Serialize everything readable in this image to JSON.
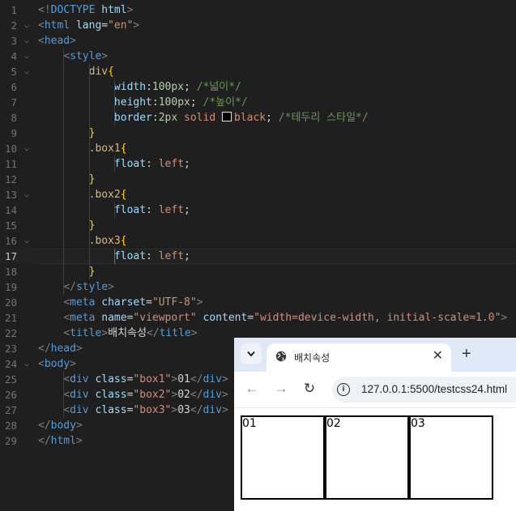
{
  "editor": {
    "current_line": 17,
    "lines": [
      {
        "n": "1",
        "tokens": [
          [
            "brk",
            "<!"
          ],
          [
            "doc",
            "DOCTYPE"
          ],
          [
            "txt",
            " "
          ],
          [
            "attr",
            "html"
          ],
          [
            "brk",
            ">"
          ]
        ]
      },
      {
        "n": "2",
        "fold": true,
        "tokens": [
          [
            "brk",
            "<"
          ],
          [
            "tag",
            "html"
          ],
          [
            "txt",
            " "
          ],
          [
            "attr",
            "lang"
          ],
          [
            "txt",
            "="
          ],
          [
            "str",
            "\"en\""
          ],
          [
            "brk",
            ">"
          ]
        ]
      },
      {
        "n": "3",
        "fold": true,
        "tokens": [
          [
            "brk",
            "<"
          ],
          [
            "tag",
            "head"
          ],
          [
            "brk",
            ">"
          ]
        ]
      },
      {
        "n": "4",
        "fold": true,
        "tokens": [
          [
            "txt",
            "    "
          ],
          [
            "brk",
            "<"
          ],
          [
            "tag",
            "style"
          ],
          [
            "brk",
            ">"
          ]
        ]
      },
      {
        "n": "5",
        "fold": true,
        "tokens": [
          [
            "txt",
            "        "
          ],
          [
            "sel",
            "div"
          ],
          [
            "y1",
            "{"
          ]
        ]
      },
      {
        "n": "6",
        "tokens": [
          [
            "txt",
            "            "
          ],
          [
            "prop",
            "width"
          ],
          [
            "txt",
            ":"
          ],
          [
            "num",
            "100px"
          ],
          [
            "txt",
            "; "
          ],
          [
            "cmt",
            "/*넓이*/"
          ]
        ]
      },
      {
        "n": "7",
        "tokens": [
          [
            "txt",
            "            "
          ],
          [
            "prop",
            "height"
          ],
          [
            "txt",
            ":"
          ],
          [
            "num",
            "100px"
          ],
          [
            "txt",
            "; "
          ],
          [
            "cmt",
            "/*높이*/"
          ]
        ]
      },
      {
        "n": "8",
        "tokens": [
          [
            "txt",
            "            "
          ],
          [
            "prop",
            "border"
          ],
          [
            "txt",
            ":"
          ],
          [
            "num",
            "2px"
          ],
          [
            "txt",
            " "
          ],
          [
            "val",
            "solid"
          ],
          [
            "txt",
            " "
          ],
          [
            "swatch",
            ""
          ],
          [
            "val",
            "black"
          ],
          [
            "txt",
            "; "
          ],
          [
            "cmt",
            "/*테두리 스타일*/"
          ]
        ]
      },
      {
        "n": "9",
        "tokens": [
          [
            "txt",
            "        "
          ],
          [
            "y1",
            "}"
          ]
        ]
      },
      {
        "n": "10",
        "fold": true,
        "tokens": [
          [
            "txt",
            "        "
          ],
          [
            "sel",
            ".box1"
          ],
          [
            "y1",
            "{"
          ]
        ]
      },
      {
        "n": "11",
        "tokens": [
          [
            "txt",
            "            "
          ],
          [
            "prop",
            "float"
          ],
          [
            "txt",
            ": "
          ],
          [
            "val",
            "left"
          ],
          [
            "txt",
            ";"
          ]
        ]
      },
      {
        "n": "12",
        "tokens": [
          [
            "txt",
            "        "
          ],
          [
            "y1",
            "}"
          ]
        ]
      },
      {
        "n": "13",
        "fold": true,
        "tokens": [
          [
            "txt",
            "        "
          ],
          [
            "sel",
            ".box2"
          ],
          [
            "y1",
            "{"
          ]
        ]
      },
      {
        "n": "14",
        "tokens": [
          [
            "txt",
            "            "
          ],
          [
            "prop",
            "float"
          ],
          [
            "txt",
            ": "
          ],
          [
            "val",
            "left"
          ],
          [
            "txt",
            ";"
          ]
        ]
      },
      {
        "n": "15",
        "tokens": [
          [
            "txt",
            "        "
          ],
          [
            "y1",
            "}"
          ]
        ]
      },
      {
        "n": "16",
        "fold": true,
        "tokens": [
          [
            "txt",
            "        "
          ],
          [
            "sel",
            ".box3"
          ],
          [
            "y1",
            "{"
          ]
        ]
      },
      {
        "n": "17",
        "tokens": [
          [
            "txt",
            "            "
          ],
          [
            "prop",
            "float"
          ],
          [
            "txt",
            ": "
          ],
          [
            "val",
            "left"
          ],
          [
            "txt",
            ";"
          ]
        ]
      },
      {
        "n": "18",
        "tokens": [
          [
            "txt",
            "        "
          ],
          [
            "y1",
            "}"
          ]
        ]
      },
      {
        "n": "19",
        "tokens": [
          [
            "txt",
            "    "
          ],
          [
            "brk",
            "</"
          ],
          [
            "tag",
            "style"
          ],
          [
            "brk",
            ">"
          ]
        ]
      },
      {
        "n": "20",
        "tokens": [
          [
            "txt",
            "    "
          ],
          [
            "brk",
            "<"
          ],
          [
            "tag",
            "meta"
          ],
          [
            "txt",
            " "
          ],
          [
            "attr",
            "charset"
          ],
          [
            "txt",
            "="
          ],
          [
            "str",
            "\"UTF-8\""
          ],
          [
            "brk",
            ">"
          ]
        ]
      },
      {
        "n": "21",
        "tokens": [
          [
            "txt",
            "    "
          ],
          [
            "brk",
            "<"
          ],
          [
            "tag",
            "meta"
          ],
          [
            "txt",
            " "
          ],
          [
            "attr",
            "name"
          ],
          [
            "txt",
            "="
          ],
          [
            "str",
            "\"viewport\""
          ],
          [
            "txt",
            " "
          ],
          [
            "attr",
            "content"
          ],
          [
            "txt",
            "="
          ],
          [
            "str",
            "\"width=device-width, initial-scale=1.0\""
          ],
          [
            "brk",
            ">"
          ]
        ]
      },
      {
        "n": "22",
        "tokens": [
          [
            "txt",
            "    "
          ],
          [
            "brk",
            "<"
          ],
          [
            "tag",
            "title"
          ],
          [
            "brk",
            ">"
          ],
          [
            "txt",
            "배치속성"
          ],
          [
            "brk",
            "</"
          ],
          [
            "tag",
            "title"
          ],
          [
            "brk",
            ">"
          ]
        ]
      },
      {
        "n": "23",
        "tokens": [
          [
            "brk",
            "</"
          ],
          [
            "tag",
            "head"
          ],
          [
            "brk",
            ">"
          ]
        ]
      },
      {
        "n": "24",
        "fold": true,
        "tokens": [
          [
            "brk",
            "<"
          ],
          [
            "tag",
            "body"
          ],
          [
            "brk",
            ">"
          ]
        ]
      },
      {
        "n": "25",
        "tokens": [
          [
            "txt",
            "    "
          ],
          [
            "brk",
            "<"
          ],
          [
            "tag",
            "div"
          ],
          [
            "txt",
            " "
          ],
          [
            "attr",
            "class"
          ],
          [
            "txt",
            "="
          ],
          [
            "str",
            "\"box1\""
          ],
          [
            "brk",
            ">"
          ],
          [
            "txt",
            "01"
          ],
          [
            "brk",
            "</"
          ],
          [
            "tag",
            "div"
          ],
          [
            "brk",
            ">"
          ]
        ]
      },
      {
        "n": "26",
        "tokens": [
          [
            "txt",
            "    "
          ],
          [
            "brk",
            "<"
          ],
          [
            "tag",
            "div"
          ],
          [
            "txt",
            " "
          ],
          [
            "attr",
            "class"
          ],
          [
            "txt",
            "="
          ],
          [
            "str",
            "\"box2\""
          ],
          [
            "brk",
            ">"
          ],
          [
            "txt",
            "02"
          ],
          [
            "brk",
            "</"
          ],
          [
            "tag",
            "div"
          ],
          [
            "brk",
            ">"
          ]
        ]
      },
      {
        "n": "27",
        "tokens": [
          [
            "txt",
            "    "
          ],
          [
            "brk",
            "<"
          ],
          [
            "tag",
            "div"
          ],
          [
            "txt",
            " "
          ],
          [
            "attr",
            "class"
          ],
          [
            "txt",
            "="
          ],
          [
            "str",
            "\"box3\""
          ],
          [
            "brk",
            ">"
          ],
          [
            "txt",
            "03"
          ],
          [
            "brk",
            "</"
          ],
          [
            "tag",
            "div"
          ],
          [
            "brk",
            ">"
          ]
        ]
      },
      {
        "n": "28",
        "tokens": [
          [
            "brk",
            "</"
          ],
          [
            "tag",
            "body"
          ],
          [
            "brk",
            ">"
          ]
        ]
      },
      {
        "n": "29",
        "tokens": [
          [
            "brk",
            "</"
          ],
          [
            "tag",
            "html"
          ],
          [
            "brk",
            ">"
          ]
        ]
      }
    ]
  },
  "browser": {
    "tab_menu_icon": "chevron-down-icon",
    "tab_title": "배치속성",
    "tab_close": "✕",
    "new_tab": "+",
    "back": "←",
    "forward": "→",
    "reload": "↻",
    "info_icon": "i",
    "url": "127.0.0.1:5500/testcss24.html",
    "boxes": [
      "01",
      "02",
      "03"
    ]
  }
}
